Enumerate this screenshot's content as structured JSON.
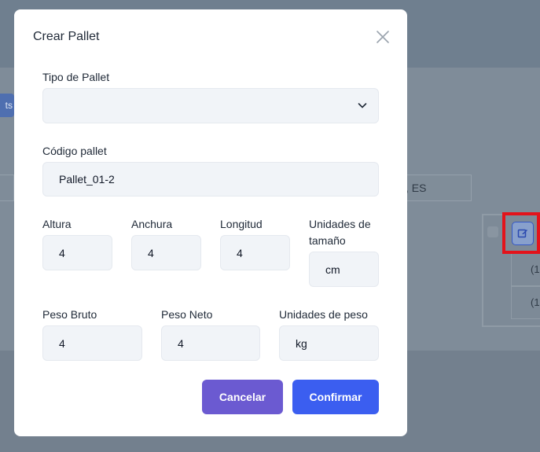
{
  "background": {
    "left_button_label": "ts",
    "filter_input_value": "s, ES",
    "table_cells": [
      "(1",
      "(1"
    ]
  },
  "modal": {
    "title": "Crear Pallet",
    "fields": {
      "tipo_pallet": {
        "label": "Tipo de Pallet",
        "value": ""
      },
      "codigo_pallet": {
        "label": "Código pallet",
        "value": "Pallet_01-2"
      },
      "altura": {
        "label": "Altura",
        "value": "4"
      },
      "anchura": {
        "label": "Anchura",
        "value": "4"
      },
      "longitud": {
        "label": "Longitud",
        "value": "4"
      },
      "unidades_tamano": {
        "label_line1": "Unidades de",
        "label_line2": "tamaño",
        "value": "cm"
      },
      "peso_bruto": {
        "label": "Peso Bruto",
        "value": "4"
      },
      "peso_neto": {
        "label": "Peso Neto",
        "value": "4"
      },
      "unidades_peso": {
        "label": "Unidades de peso",
        "value": "kg"
      }
    },
    "buttons": {
      "cancel": "Cancelar",
      "confirm": "Confirmar"
    }
  },
  "colors": {
    "cancel_button": "#6b5ad1",
    "confirm_button": "#3b5ef0",
    "highlight": "#e3131b"
  },
  "icons": {
    "close": "close-icon",
    "select": "chevron-down-icon",
    "edit": "edit-icon"
  }
}
